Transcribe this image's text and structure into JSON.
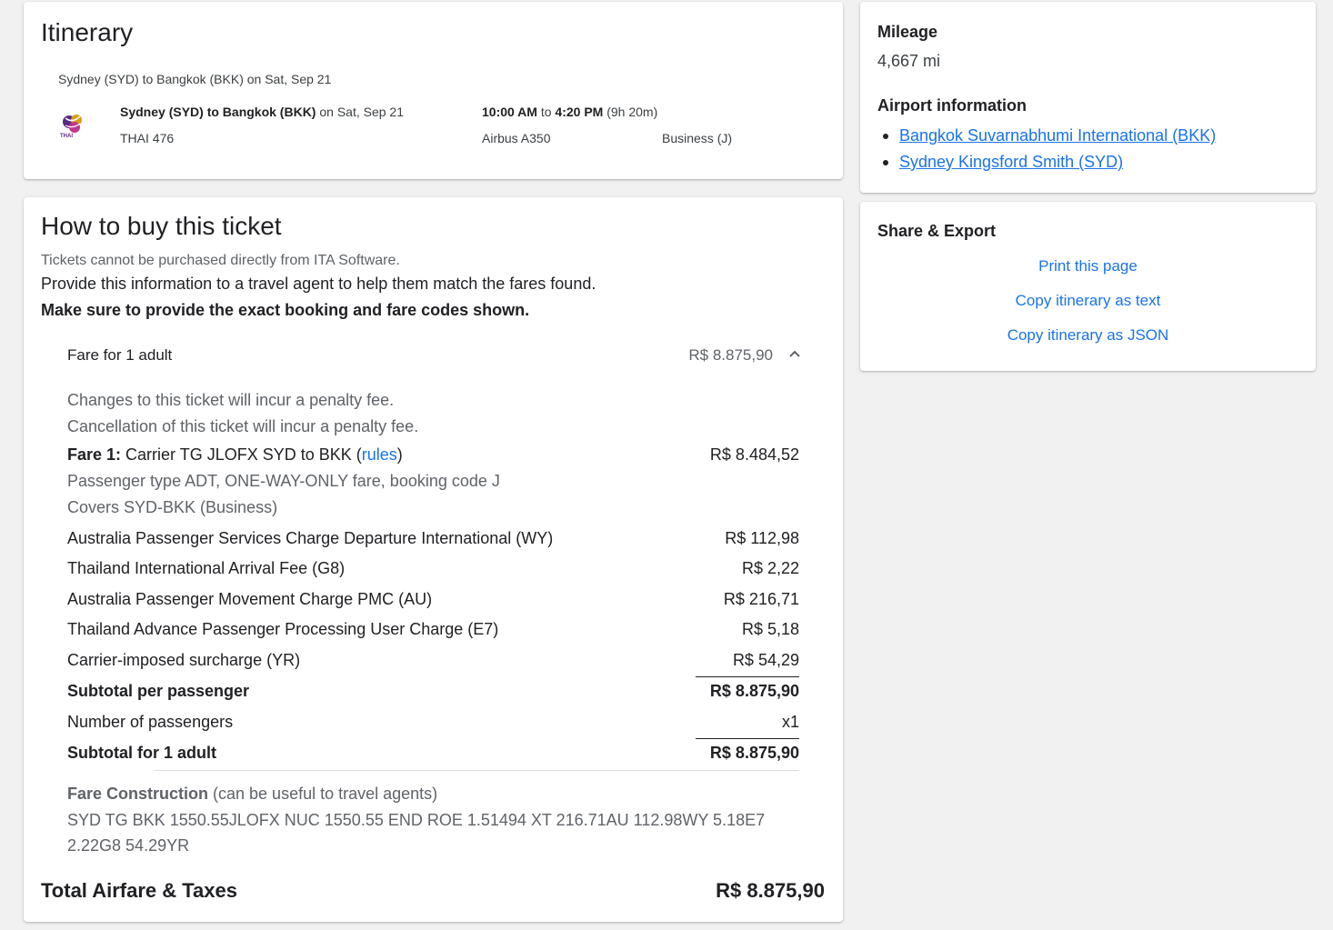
{
  "itinerary": {
    "title": "Itinerary",
    "route_summary": "Sydney (SYD) to Bangkok (BKK) on Sat, Sep 21",
    "flight": {
      "airline_logo_text": "THAI",
      "route": "Sydney (SYD) to Bangkok (BKK)",
      "date_suffix": " on Sat, Sep 21",
      "flight_number": "THAI 476",
      "depart": "10:00 AM",
      "to": " to ",
      "arrive": "4:20 PM",
      "duration": " (9h 20m)",
      "aircraft": "Airbus A350",
      "cabin": "Business (J)"
    }
  },
  "buy": {
    "title": "How to buy this ticket",
    "notice": "Tickets cannot be purchased directly from ITA Software.",
    "provide": "Provide this information to a travel agent to help them match the fares found.",
    "make_sure": "Make sure to provide the exact booking and fare codes shown.",
    "fare_header": {
      "label": "Fare for 1 adult",
      "amount": "R$ 8.875,90"
    },
    "penalties": [
      "Changes to this ticket will incur a penalty fee.",
      "Cancellation of this ticket will incur a penalty fee."
    ],
    "fare1": {
      "label": "Fare 1:",
      "text": " Carrier TG JLOFX SYD to BKK (",
      "rules": "rules",
      "close": ")",
      "amount": "R$ 8.484,52",
      "passenger_type": "Passenger type ADT, ONE-WAY-ONLY fare, booking code J",
      "covers": "Covers SYD-BKK (Business)"
    },
    "taxes": [
      {
        "label": "Australia Passenger Services Charge Departure International (WY)",
        "amount": "R$ 112,98"
      },
      {
        "label": "Thailand International Arrival Fee (G8)",
        "amount": "R$ 2,22"
      },
      {
        "label": "Australia Passenger Movement Charge PMC (AU)",
        "amount": "R$ 216,71"
      },
      {
        "label": "Thailand Advance Passenger Processing User Charge (E7)",
        "amount": "R$ 5,18"
      },
      {
        "label": "Carrier-imposed surcharge (YR)",
        "amount": "R$ 54,29"
      }
    ],
    "subtotal_per_passenger": {
      "label": "Subtotal per passenger",
      "amount": "R$ 8.875,90"
    },
    "number_of_passengers": {
      "label": "Number of passengers",
      "amount": "x1"
    },
    "subtotal_adult": {
      "label": "Subtotal for 1 adult",
      "amount": "R$ 8.875,90"
    },
    "fare_construction": {
      "label": "Fare Construction",
      "note": " (can be useful to travel agents)",
      "line1": "SYD TG BKK 1550.55JLOFX NUC 1550.55 END ROE 1.51494 XT 216.71AU 112.98WY 5.18E7",
      "line2": "2.22G8 54.29YR"
    },
    "total": {
      "label": "Total Airfare & Taxes",
      "amount": "R$ 8.875,90"
    }
  },
  "mileage": {
    "title": "Mileage",
    "value": "4,667 mi",
    "airport_title": "Airport information",
    "airports": [
      "Bangkok Suvarnabhumi International (BKK)",
      "Sydney Kingsford Smith (SYD)"
    ]
  },
  "share": {
    "title": "Share & Export",
    "links": [
      "Print this page",
      "Copy itinerary as text",
      "Copy itinerary as JSON"
    ]
  },
  "colors": {
    "link": "#1a73e8",
    "background": "#f1f1f1",
    "card": "#ffffff",
    "logo_purple": "#5b2a86",
    "logo_gold": "#d4a017"
  }
}
